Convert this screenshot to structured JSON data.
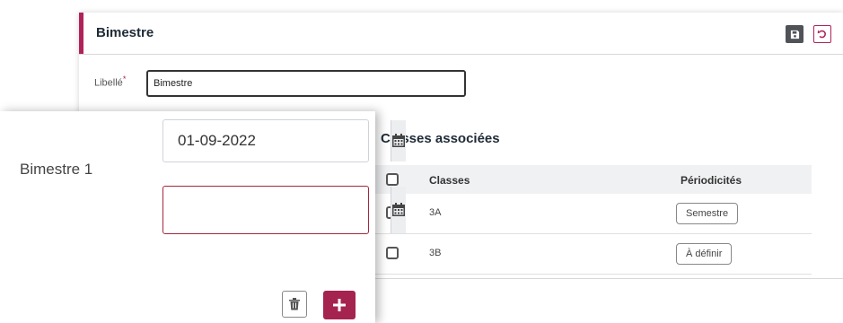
{
  "panel": {
    "title": "Bimestre",
    "libelle_label": "Libellé",
    "required_mark": "*",
    "libelle_value": "Bimestre",
    "section_title": "Classes associées",
    "table": {
      "headers": [
        "Classes",
        "Périodicités"
      ],
      "rows": [
        {
          "classe": "3A",
          "periodicite": "Semestre"
        },
        {
          "classe": "3B",
          "periodicite": "À définir"
        }
      ]
    }
  },
  "card": {
    "period_label": "Bimestre 1",
    "start_date": "01-09-2022",
    "end_date": ""
  },
  "icons": {
    "save": "save-icon",
    "undo": "undo-icon",
    "calendar": "calendar-icon",
    "trash": "trash-icon",
    "plus": "plus-icon"
  },
  "colors": {
    "accent": "#b0235a",
    "add_button": "#a5234f",
    "invalid_border": "#a5263c",
    "save_button": "#4f5358"
  }
}
